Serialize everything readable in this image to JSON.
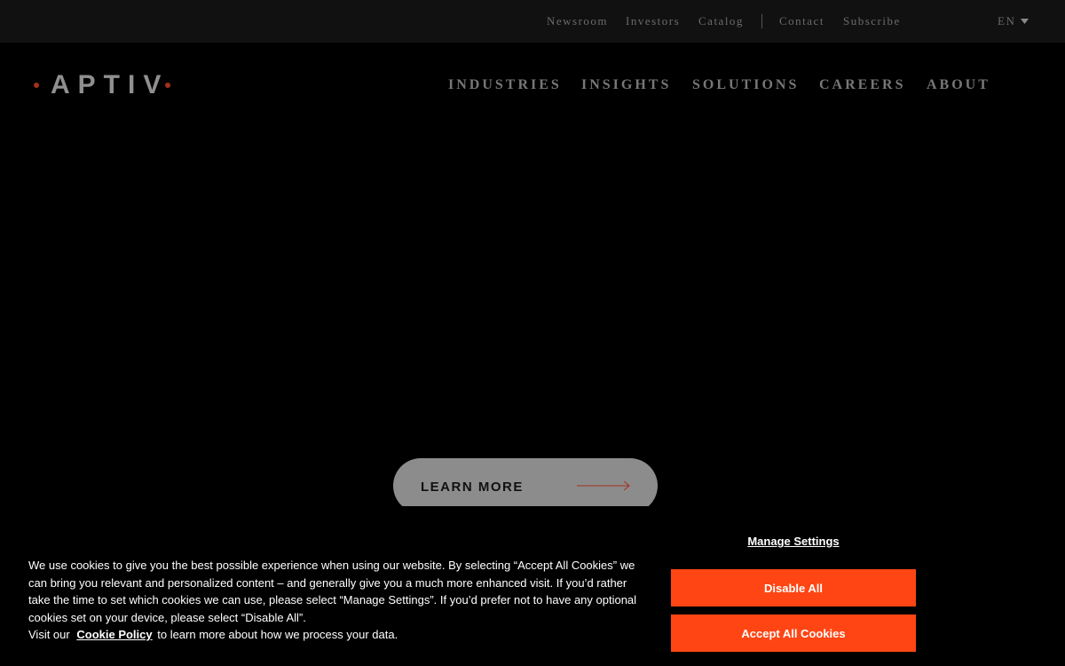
{
  "utility_nav": {
    "items": [
      "Newsroom",
      "Investors",
      "Catalog",
      "Contact",
      "Subscribe"
    ],
    "language": "EN"
  },
  "brand": {
    "logo_text": "APTIV",
    "accent_color": "#a3301f"
  },
  "main_nav": {
    "items": [
      "INDUSTRIES",
      "INSIGHTS",
      "SOLUTIONS",
      "CAREERS",
      "ABOUT"
    ]
  },
  "hero": {
    "cta_label": "LEARN MORE",
    "cta_arrow_color": "#a3301f"
  },
  "cookie_banner": {
    "message": "We use cookies to give you the best possible experience when using our website. By selecting “Accept All Cookies” we can bring you relevant and personalized content – and generally give you a much more enhanced visit. If you’d rather take the time to set which cookies we can use, please select “Manage Settings”. If you’d prefer not to have any optional cookies set on your device, please select “Disable All”.",
    "visit_prefix": "Visit our",
    "policy_link": "Cookie Policy",
    "visit_suffix": "to learn more about how we process your data.",
    "manage_settings": "Manage Settings",
    "disable_all": "Disable All",
    "accept_all": "Accept All Cookies",
    "button_color": "#ff4513"
  }
}
